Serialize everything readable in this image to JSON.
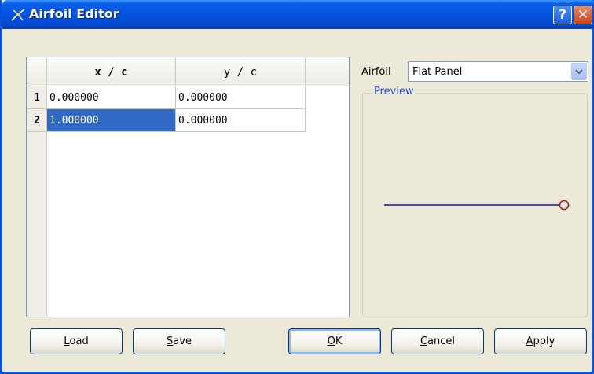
{
  "window": {
    "title": "Airfoil Editor",
    "help_symbol": "?",
    "close_symbol": "✕"
  },
  "table": {
    "columns": [
      "",
      "x / c",
      "y / c"
    ],
    "rows": [
      {
        "num": "1",
        "x": "0.000000",
        "y": "0.000000"
      },
      {
        "num": "2",
        "x": "1.000000",
        "y": "0.000000"
      }
    ],
    "selected": {
      "row": 2,
      "column": "x / c"
    }
  },
  "airfoil": {
    "label": "Airfoil",
    "selected": "Flat Panel"
  },
  "preview": {
    "label": "Preview"
  },
  "buttons": {
    "load": {
      "pre": "",
      "mnemonic": "L",
      "post": "oad"
    },
    "save": {
      "pre": "",
      "mnemonic": "S",
      "post": "ave"
    },
    "ok": {
      "pre": "",
      "mnemonic": "O",
      "post": "K"
    },
    "cancel": {
      "pre": "",
      "mnemonic": "C",
      "post": "ancel"
    },
    "apply": {
      "pre": "",
      "mnemonic": "A",
      "post": "pply"
    }
  },
  "colors": {
    "titlebar": "#0553e0",
    "selection": "#316ac5",
    "preview_line": "#4a4a9a",
    "preview_marker": "#9a1f1f",
    "group_label": "#1f4ed0"
  },
  "icons": {
    "app": "airfoil-app-icon",
    "dropdown": "chevron-down-icon"
  }
}
